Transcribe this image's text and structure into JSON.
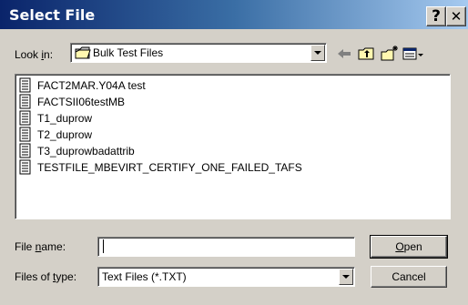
{
  "window": {
    "title": "Select File",
    "help_label": "?",
    "close_label": "✕"
  },
  "look_in": {
    "label_pre": "Look ",
    "label_hot": "i",
    "label_post": "n:",
    "value": "Bulk Test Files",
    "icon": "folder-icon"
  },
  "toolbar": {
    "icons": [
      "back-arrow-icon",
      "up-folder-icon",
      "new-folder-icon",
      "view-menu-icon"
    ]
  },
  "files": [
    {
      "name": "FACT2MAR.Y04A test",
      "icon": "text-file-icon"
    },
    {
      "name": "FACTSII06testMB",
      "icon": "text-file-icon"
    },
    {
      "name": "T1_duprow",
      "icon": "text-file-icon"
    },
    {
      "name": "T2_duprow",
      "icon": "text-file-icon"
    },
    {
      "name": "T3_duprowbadattrib",
      "icon": "text-file-icon"
    },
    {
      "name": "TESTFILE_MBEVIRT_CERTIFY_ONE_FAILED_TAFS",
      "icon": "text-file-icon"
    }
  ],
  "file_name": {
    "label_pre": "File ",
    "label_hot": "n",
    "label_post": "ame:",
    "value": "",
    "placeholder": ""
  },
  "file_type": {
    "label_pre": "Files of ",
    "label_hot": "t",
    "label_post": "ype:",
    "value": "Text Files (*.TXT)"
  },
  "buttons": {
    "open_hot": "O",
    "open_rest": "pen",
    "cancel": "Cancel"
  },
  "colors": {
    "title_start": "#0a246a",
    "title_end": "#a6caf0",
    "face": "#d4d0c8"
  }
}
